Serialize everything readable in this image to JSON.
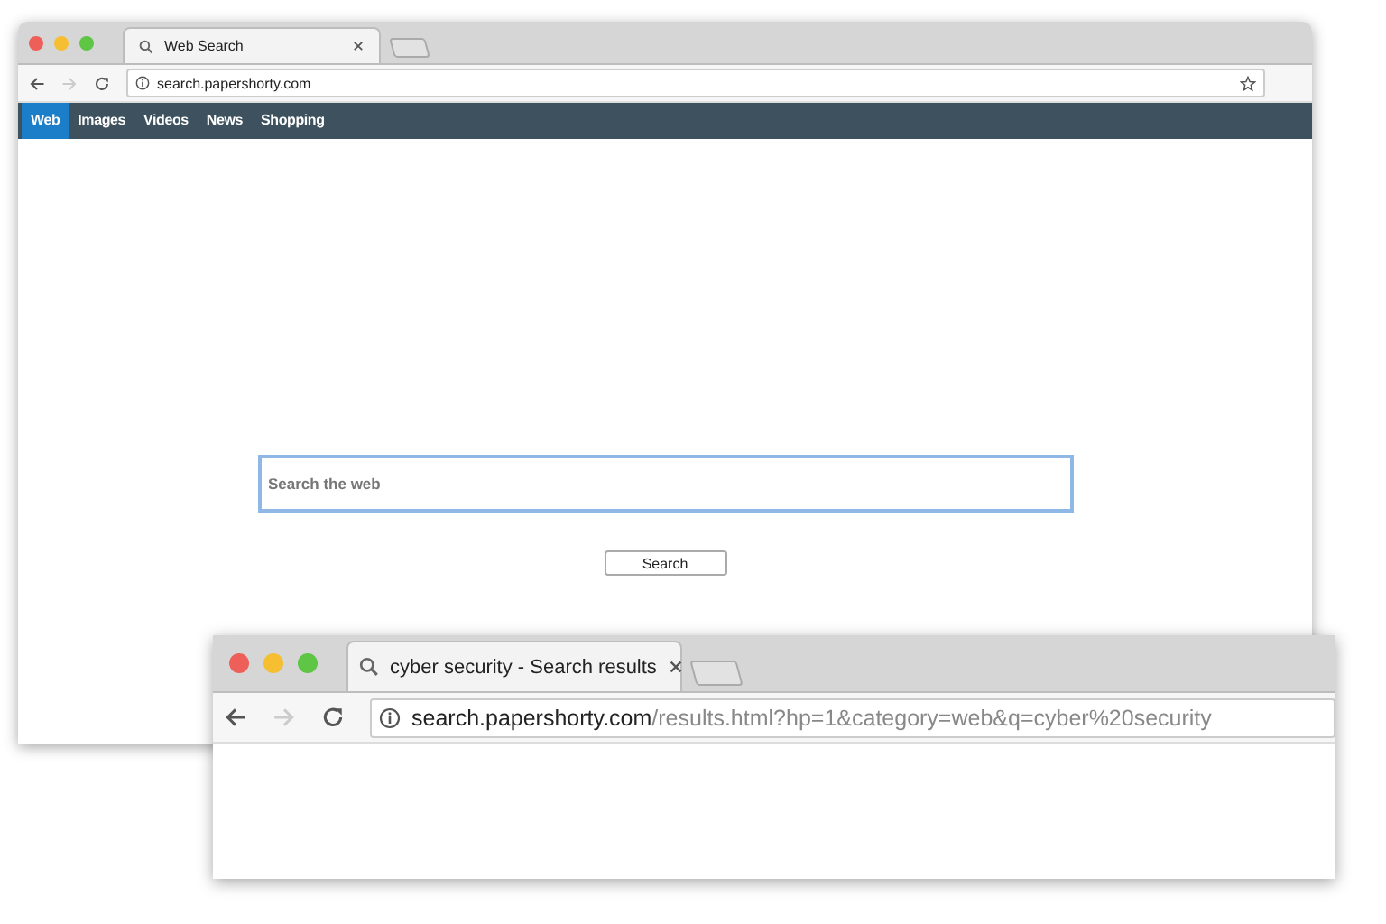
{
  "windows": [
    {
      "tab": {
        "title": "Web Search"
      },
      "address": {
        "host": "search.papershorty.com"
      },
      "nav": [
        {
          "label": "Web",
          "selected": true
        },
        {
          "label": "Images",
          "selected": false
        },
        {
          "label": "Videos",
          "selected": false
        },
        {
          "label": "News",
          "selected": false
        },
        {
          "label": "Shopping",
          "selected": false
        }
      ],
      "search": {
        "placeholder": "Search the web",
        "button": "Search"
      }
    },
    {
      "tab": {
        "title": "cyber security - Search results"
      },
      "address": {
        "host": "search.papershorty.com",
        "path": "/results.html?hp=1&category=web&q=cyber%20security"
      }
    }
  ]
}
